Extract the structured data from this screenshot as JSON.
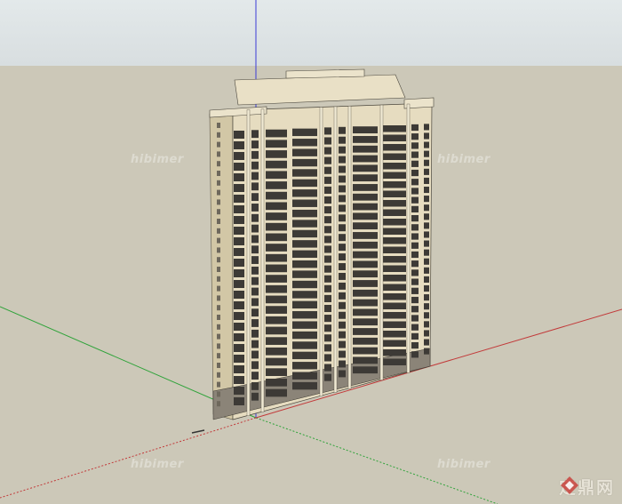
{
  "viewport": {
    "sky_color": "#dde3e5",
    "ground_color": "#ccc8b8",
    "axes": {
      "red": "#c23a3a",
      "green": "#2fa33a",
      "blue": "#3b3bd6"
    },
    "building": {
      "facade_color": "#e6dcc0",
      "window_color": "#3d3a36",
      "side_color": "#d2c7a6",
      "floors": 26
    }
  },
  "watermarks": {
    "text": "hibimer"
  },
  "brand": {
    "logo_icon": "diamond-logo-icon",
    "text": "定鼎网"
  }
}
